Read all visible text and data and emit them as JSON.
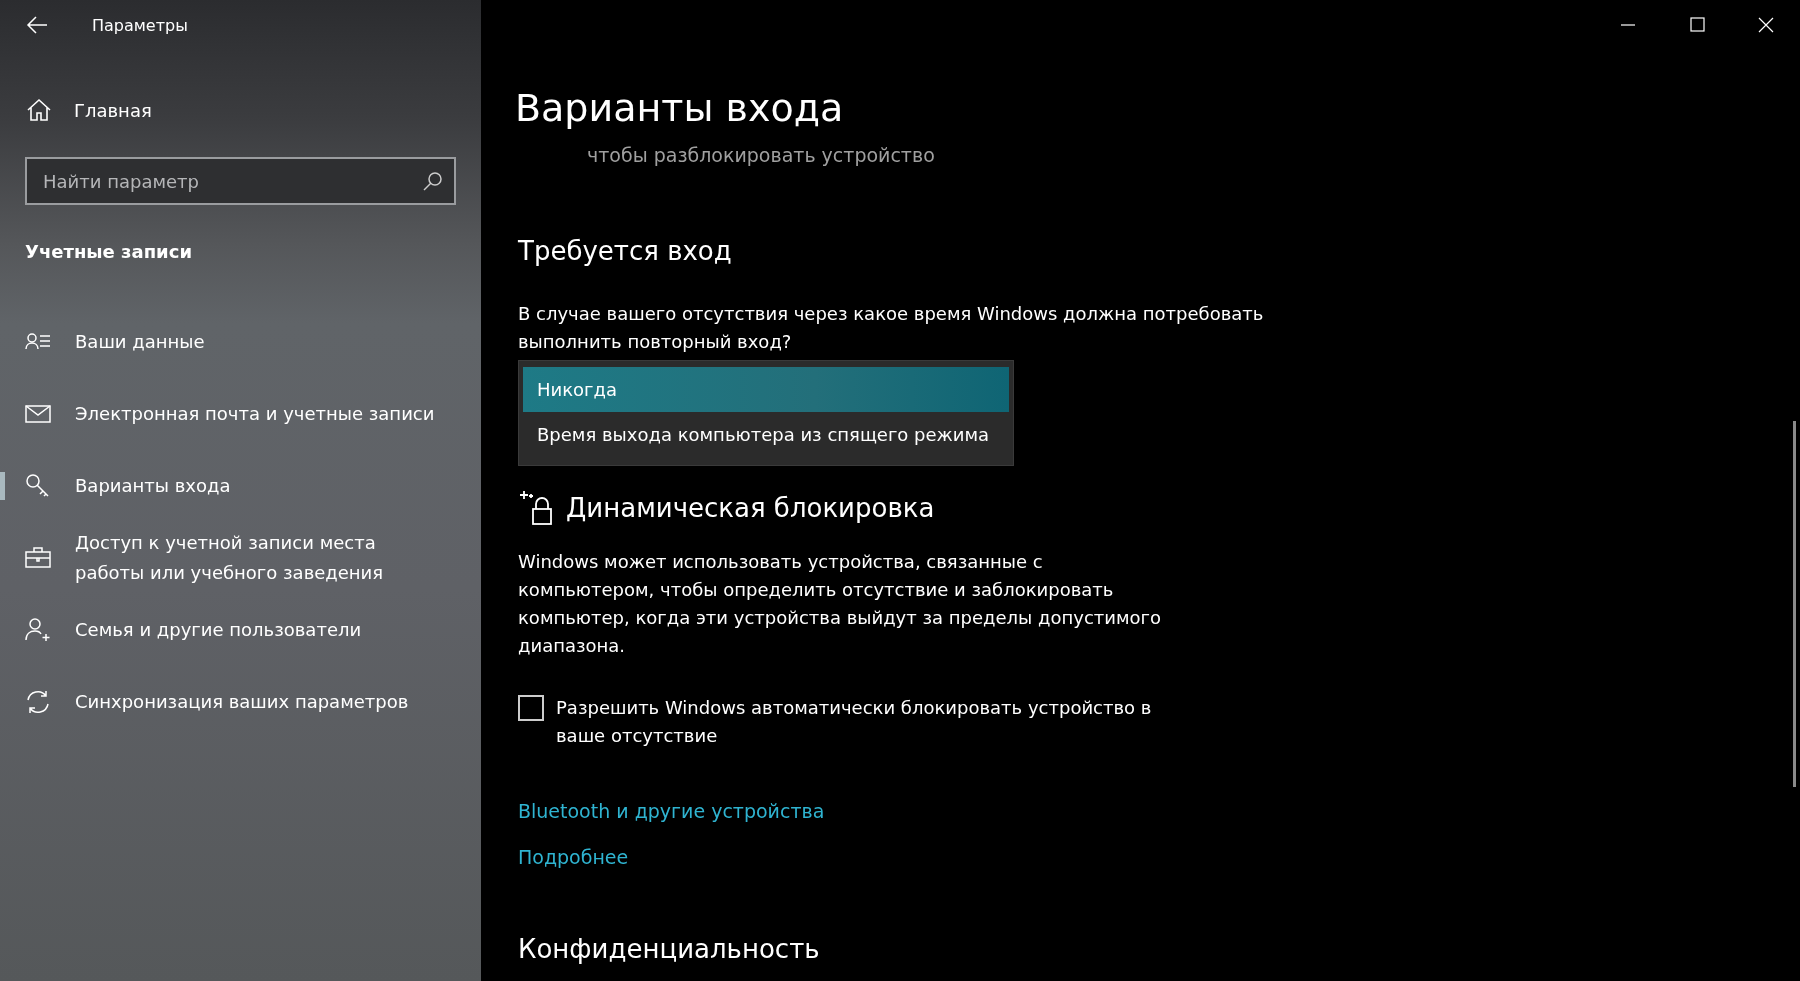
{
  "window": {
    "title": "Параметры"
  },
  "sidebar": {
    "home": "Главная",
    "search": {
      "placeholder": "Найти параметр"
    },
    "section": "Учетные записи",
    "items": [
      {
        "label": "Ваши данные",
        "selected": false
      },
      {
        "label": "Электронная почта и учетные записи",
        "selected": false
      },
      {
        "label": "Варианты входа",
        "selected": true
      },
      {
        "label": "Доступ к учетной записи места работы или учебного заведения",
        "selected": false
      },
      {
        "label": "Семья и другие пользователи",
        "selected": false
      },
      {
        "label": "Синхронизация ваших параметров",
        "selected": false
      }
    ]
  },
  "page": {
    "title": "Варианты входа",
    "subtitle": "чтобы разблокировать устройство",
    "require_signin": {
      "heading": "Требуется вход",
      "question": "В случае вашего отсутствия через какое время Windows должна потребовать выполнить повторный вход?",
      "options": [
        {
          "label": "Никогда",
          "selected": true
        },
        {
          "label": "Время выхода компьютера из спящего режима",
          "selected": false
        }
      ]
    },
    "dynamic_lock": {
      "heading": "Динамическая блокировка",
      "description": "Windows может использовать устройства, связанные с компьютером, чтобы определить отсутствие и заблокировать компьютер, когда эти устройства выйдут за пределы допустимого диапазона.",
      "checkbox": {
        "label": "Разрешить Windows автоматически блокировать устройство в ваше отсутствие",
        "checked": false
      },
      "links": [
        "Bluetooth и другие устройства",
        "Подробнее"
      ]
    },
    "privacy": {
      "heading": "Конфиденциальность"
    }
  }
}
